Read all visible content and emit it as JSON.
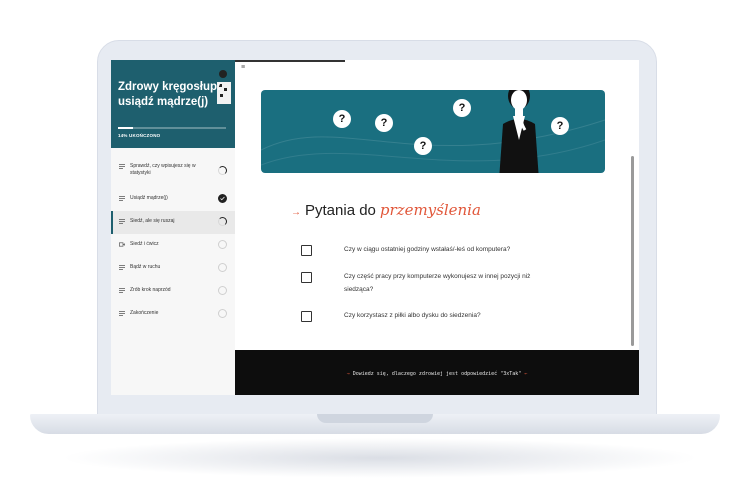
{
  "sidebar": {
    "title": "Zdrowy kręgosłup: usiądź mądrze(j)",
    "progress_label": "14% UKOŃCZONO",
    "progress": 0.14,
    "items": [
      {
        "label": "Sprawdź, czy wpisujesz się w statystyki",
        "icon": "lines-icon",
        "status": "partial"
      },
      {
        "label": "Usiądź mądrze(j)",
        "icon": "lines-icon",
        "status": "done"
      },
      {
        "label": "Siedź, ale się ruszaj",
        "icon": "lines-icon",
        "status": "partial"
      },
      {
        "label": "Siedź i ćwicz",
        "icon": "video-icon",
        "status": "empty"
      },
      {
        "label": "Bądź w ruchu",
        "icon": "lines-icon",
        "status": "empty"
      },
      {
        "label": "Zrób krok naprzód",
        "icon": "lines-icon",
        "status": "empty"
      },
      {
        "label": "Zakończenie",
        "icon": "lines-icon",
        "status": "empty"
      }
    ]
  },
  "main": {
    "menu_icon": "≡",
    "banner": {
      "question_mark": "?"
    },
    "heading": {
      "arrow": "→",
      "prefix": "Pytania do",
      "accent": "przemyślenia"
    },
    "questions": [
      "Czy w ciągu ostatniej godziny wstałaś/-łeś od komputera?",
      "Czy część pracy przy komputerze wykonujesz w innej pozycji niż siedząca?",
      "Czy korzystasz z piłki albo dysku do siedzenia?"
    ],
    "footer": {
      "arrow_left": "→",
      "text": "Dowiedz się, dlaczego zdrowiej jest odpowiedzieć \"3xTak\"",
      "arrow_right": "←"
    }
  },
  "colors": {
    "brand": "#1e5f6e",
    "accent": "#e1573a",
    "footer_bg": "#0d0d0d"
  }
}
